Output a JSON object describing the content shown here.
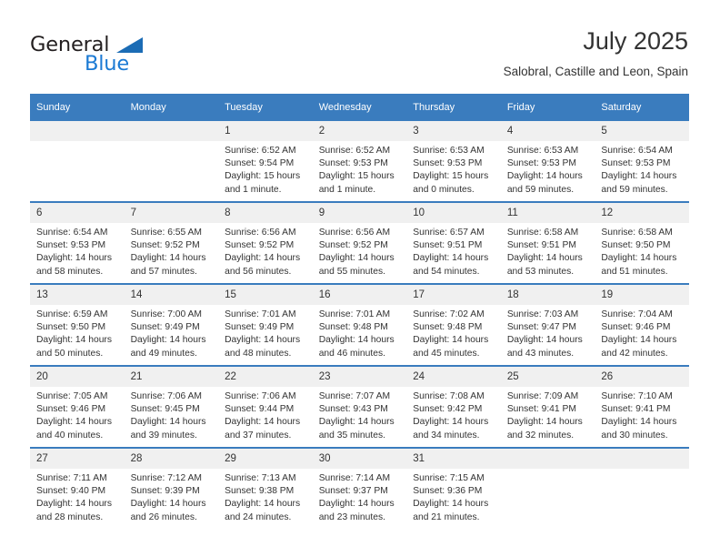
{
  "brand": {
    "name_part1": "General",
    "name_part2": "Blue",
    "accent_color": "#1b7ad4",
    "header_color": "#3a7cbe"
  },
  "header": {
    "month_title": "July 2025",
    "location": "Salobral, Castille and Leon, Spain"
  },
  "calendar": {
    "weekday_headers": [
      "Sunday",
      "Monday",
      "Tuesday",
      "Wednesday",
      "Thursday",
      "Friday",
      "Saturday"
    ],
    "weeks": [
      [
        {
          "day": "",
          "empty": true
        },
        {
          "day": "",
          "empty": true
        },
        {
          "day": "1",
          "sunrise": "Sunrise: 6:52 AM",
          "sunset": "Sunset: 9:54 PM",
          "daylight": "Daylight: 15 hours and 1 minute."
        },
        {
          "day": "2",
          "sunrise": "Sunrise: 6:52 AM",
          "sunset": "Sunset: 9:53 PM",
          "daylight": "Daylight: 15 hours and 1 minute."
        },
        {
          "day": "3",
          "sunrise": "Sunrise: 6:53 AM",
          "sunset": "Sunset: 9:53 PM",
          "daylight": "Daylight: 15 hours and 0 minutes."
        },
        {
          "day": "4",
          "sunrise": "Sunrise: 6:53 AM",
          "sunset": "Sunset: 9:53 PM",
          "daylight": "Daylight: 14 hours and 59 minutes."
        },
        {
          "day": "5",
          "sunrise": "Sunrise: 6:54 AM",
          "sunset": "Sunset: 9:53 PM",
          "daylight": "Daylight: 14 hours and 59 minutes."
        }
      ],
      [
        {
          "day": "6",
          "sunrise": "Sunrise: 6:54 AM",
          "sunset": "Sunset: 9:53 PM",
          "daylight": "Daylight: 14 hours and 58 minutes."
        },
        {
          "day": "7",
          "sunrise": "Sunrise: 6:55 AM",
          "sunset": "Sunset: 9:52 PM",
          "daylight": "Daylight: 14 hours and 57 minutes."
        },
        {
          "day": "8",
          "sunrise": "Sunrise: 6:56 AM",
          "sunset": "Sunset: 9:52 PM",
          "daylight": "Daylight: 14 hours and 56 minutes."
        },
        {
          "day": "9",
          "sunrise": "Sunrise: 6:56 AM",
          "sunset": "Sunset: 9:52 PM",
          "daylight": "Daylight: 14 hours and 55 minutes."
        },
        {
          "day": "10",
          "sunrise": "Sunrise: 6:57 AM",
          "sunset": "Sunset: 9:51 PM",
          "daylight": "Daylight: 14 hours and 54 minutes."
        },
        {
          "day": "11",
          "sunrise": "Sunrise: 6:58 AM",
          "sunset": "Sunset: 9:51 PM",
          "daylight": "Daylight: 14 hours and 53 minutes."
        },
        {
          "day": "12",
          "sunrise": "Sunrise: 6:58 AM",
          "sunset": "Sunset: 9:50 PM",
          "daylight": "Daylight: 14 hours and 51 minutes."
        }
      ],
      [
        {
          "day": "13",
          "sunrise": "Sunrise: 6:59 AM",
          "sunset": "Sunset: 9:50 PM",
          "daylight": "Daylight: 14 hours and 50 minutes."
        },
        {
          "day": "14",
          "sunrise": "Sunrise: 7:00 AM",
          "sunset": "Sunset: 9:49 PM",
          "daylight": "Daylight: 14 hours and 49 minutes."
        },
        {
          "day": "15",
          "sunrise": "Sunrise: 7:01 AM",
          "sunset": "Sunset: 9:49 PM",
          "daylight": "Daylight: 14 hours and 48 minutes."
        },
        {
          "day": "16",
          "sunrise": "Sunrise: 7:01 AM",
          "sunset": "Sunset: 9:48 PM",
          "daylight": "Daylight: 14 hours and 46 minutes."
        },
        {
          "day": "17",
          "sunrise": "Sunrise: 7:02 AM",
          "sunset": "Sunset: 9:48 PM",
          "daylight": "Daylight: 14 hours and 45 minutes."
        },
        {
          "day": "18",
          "sunrise": "Sunrise: 7:03 AM",
          "sunset": "Sunset: 9:47 PM",
          "daylight": "Daylight: 14 hours and 43 minutes."
        },
        {
          "day": "19",
          "sunrise": "Sunrise: 7:04 AM",
          "sunset": "Sunset: 9:46 PM",
          "daylight": "Daylight: 14 hours and 42 minutes."
        }
      ],
      [
        {
          "day": "20",
          "sunrise": "Sunrise: 7:05 AM",
          "sunset": "Sunset: 9:46 PM",
          "daylight": "Daylight: 14 hours and 40 minutes."
        },
        {
          "day": "21",
          "sunrise": "Sunrise: 7:06 AM",
          "sunset": "Sunset: 9:45 PM",
          "daylight": "Daylight: 14 hours and 39 minutes."
        },
        {
          "day": "22",
          "sunrise": "Sunrise: 7:06 AM",
          "sunset": "Sunset: 9:44 PM",
          "daylight": "Daylight: 14 hours and 37 minutes."
        },
        {
          "day": "23",
          "sunrise": "Sunrise: 7:07 AM",
          "sunset": "Sunset: 9:43 PM",
          "daylight": "Daylight: 14 hours and 35 minutes."
        },
        {
          "day": "24",
          "sunrise": "Sunrise: 7:08 AM",
          "sunset": "Sunset: 9:42 PM",
          "daylight": "Daylight: 14 hours and 34 minutes."
        },
        {
          "day": "25",
          "sunrise": "Sunrise: 7:09 AM",
          "sunset": "Sunset: 9:41 PM",
          "daylight": "Daylight: 14 hours and 32 minutes."
        },
        {
          "day": "26",
          "sunrise": "Sunrise: 7:10 AM",
          "sunset": "Sunset: 9:41 PM",
          "daylight": "Daylight: 14 hours and 30 minutes."
        }
      ],
      [
        {
          "day": "27",
          "sunrise": "Sunrise: 7:11 AM",
          "sunset": "Sunset: 9:40 PM",
          "daylight": "Daylight: 14 hours and 28 minutes."
        },
        {
          "day": "28",
          "sunrise": "Sunrise: 7:12 AM",
          "sunset": "Sunset: 9:39 PM",
          "daylight": "Daylight: 14 hours and 26 minutes."
        },
        {
          "day": "29",
          "sunrise": "Sunrise: 7:13 AM",
          "sunset": "Sunset: 9:38 PM",
          "daylight": "Daylight: 14 hours and 24 minutes."
        },
        {
          "day": "30",
          "sunrise": "Sunrise: 7:14 AM",
          "sunset": "Sunset: 9:37 PM",
          "daylight": "Daylight: 14 hours and 23 minutes."
        },
        {
          "day": "31",
          "sunrise": "Sunrise: 7:15 AM",
          "sunset": "Sunset: 9:36 PM",
          "daylight": "Daylight: 14 hours and 21 minutes."
        },
        {
          "day": "",
          "empty": true
        },
        {
          "day": "",
          "empty": true
        }
      ]
    ]
  }
}
